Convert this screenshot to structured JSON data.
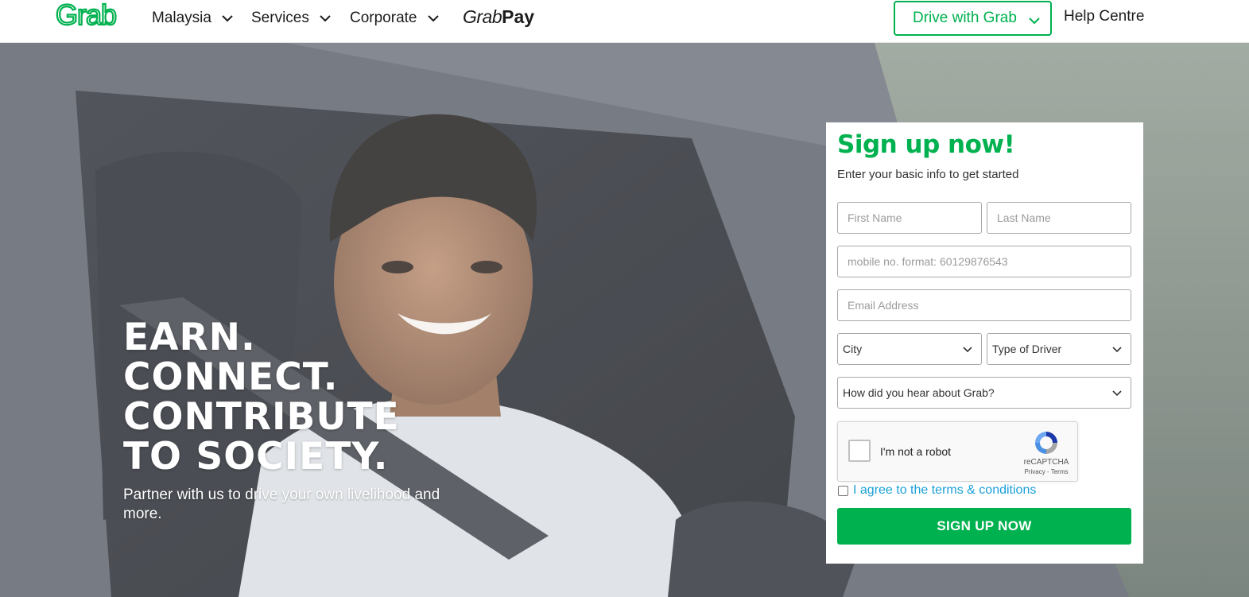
{
  "header": {
    "logo_text": "Grab",
    "nav": [
      {
        "label": "Malaysia"
      },
      {
        "label": "Services"
      },
      {
        "label": "Corporate"
      }
    ],
    "grabpay": {
      "grab": "Grab",
      "pay": "Pay"
    },
    "drive_button": "Drive with Grab",
    "help": "Help Centre"
  },
  "hero": {
    "headline": [
      "EARN.",
      "CONNECT.",
      "CONTRIBUTE",
      "TO SOCIETY."
    ],
    "subtext": "Partner with us to drive your own livelihood and more."
  },
  "signup": {
    "title": "Sign up now!",
    "subtitle": "Enter your basic info to get started",
    "first_name_placeholder": "First Name",
    "last_name_placeholder": "Last Name",
    "mobile_placeholder": "mobile no. format: 60129876543",
    "email_placeholder": "Email Address",
    "city_selected": "City",
    "driver_type_selected": "Type of Driver",
    "hear_about_selected": "How did you hear about Grab?",
    "recaptcha": {
      "label": "I'm not a robot",
      "brand": "reCAPTCHA",
      "links": "Privacy - Terms"
    },
    "terms_label": "I agree to the terms & conditions",
    "submit_label": "SIGN UP NOW"
  },
  "colors": {
    "brand_green": "#00b14f",
    "link_blue": "#1a9fd8"
  }
}
